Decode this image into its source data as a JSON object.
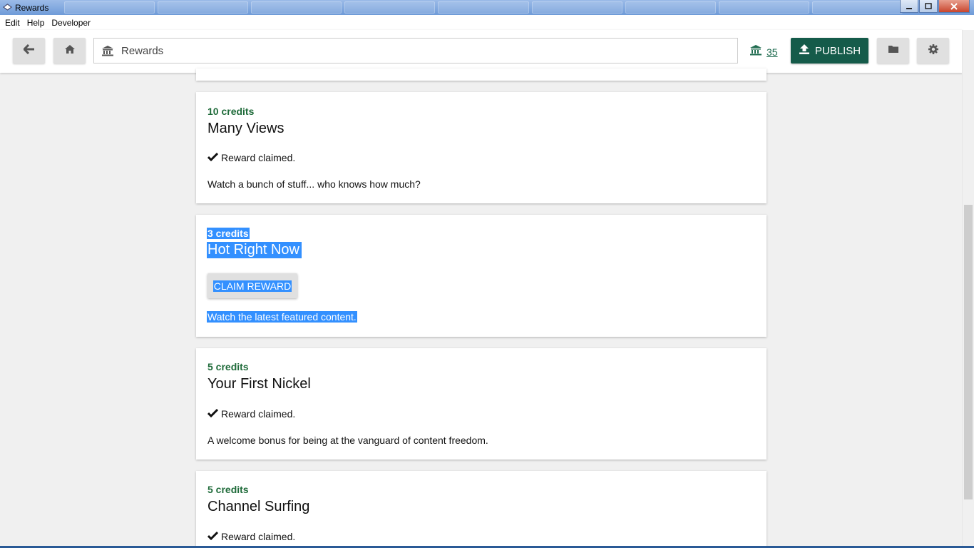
{
  "window": {
    "title": "Rewards"
  },
  "menu": {
    "items": [
      "Edit",
      "Help",
      "Developer"
    ]
  },
  "header": {
    "address": "Rewards",
    "balance": "35",
    "publish_label": "PUBLISH"
  },
  "rewards": [
    {
      "credits": "10 credits",
      "title": "Many Views",
      "status": "Reward claimed.",
      "description": "Watch a bunch of stuff... who knows how much?"
    },
    {
      "credits": "3 credits",
      "title": "Hot Right Now",
      "button": "CLAIM REWARD",
      "description": "Watch the latest featured content."
    },
    {
      "credits": "5 credits",
      "title": "Your First Nickel",
      "status": "Reward claimed.",
      "description": "A welcome bonus for being at the vanguard of content freedom."
    },
    {
      "credits": "5 credits",
      "title": "Channel Surfing",
      "status": "Reward claimed."
    }
  ],
  "colors": {
    "accent": "#155b4a",
    "credits": "#1f6b3a",
    "selection": "#3390ff"
  }
}
